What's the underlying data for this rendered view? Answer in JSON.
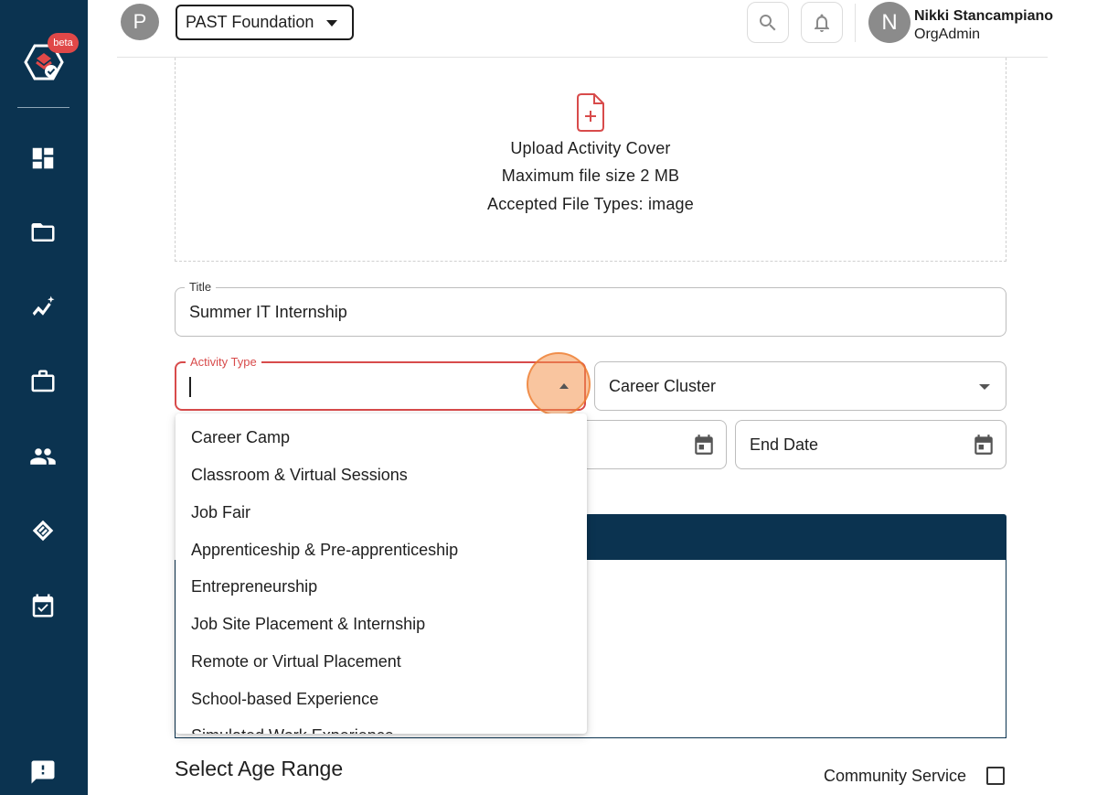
{
  "sidebar": {
    "beta_badge": "beta",
    "icons": [
      "dashboard-icon",
      "folder-icon",
      "analytics-icon",
      "briefcase-icon",
      "people-icon",
      "handshake-icon",
      "calendar-check-icon",
      "feedback-icon"
    ]
  },
  "header": {
    "org_initial": "P",
    "org_name": "PAST Foundation",
    "user_initial": "N",
    "user_name": "Nikki Stancampiano",
    "user_role": "OrgAdmin"
  },
  "upload": {
    "title": "Upload Activity Cover",
    "max_size": "Maximum file size 2 MB",
    "accepted": "Accepted File Types: image"
  },
  "form": {
    "title_label": "Title",
    "title_value": "Summer IT Internship",
    "activity_type_label": "Activity Type",
    "career_cluster_placeholder": "Career Cluster",
    "end_date_placeholder": "End Date"
  },
  "activity_type_options": [
    "Career Camp",
    "Classroom & Virtual Sessions",
    "Job Fair",
    "Apprenticeship & Pre-apprenticeship",
    "Entrepreneurship",
    "Job Site Placement & Internship",
    "Remote or Virtual Placement",
    "School-based Experience",
    "Simulated Work Experience"
  ],
  "age_range": {
    "title": "Select Age Range",
    "community_service_label": "Community Service"
  },
  "colors": {
    "sidebar": "#0b3350",
    "accent_red": "#d84b4b",
    "highlight": "#f49650"
  }
}
